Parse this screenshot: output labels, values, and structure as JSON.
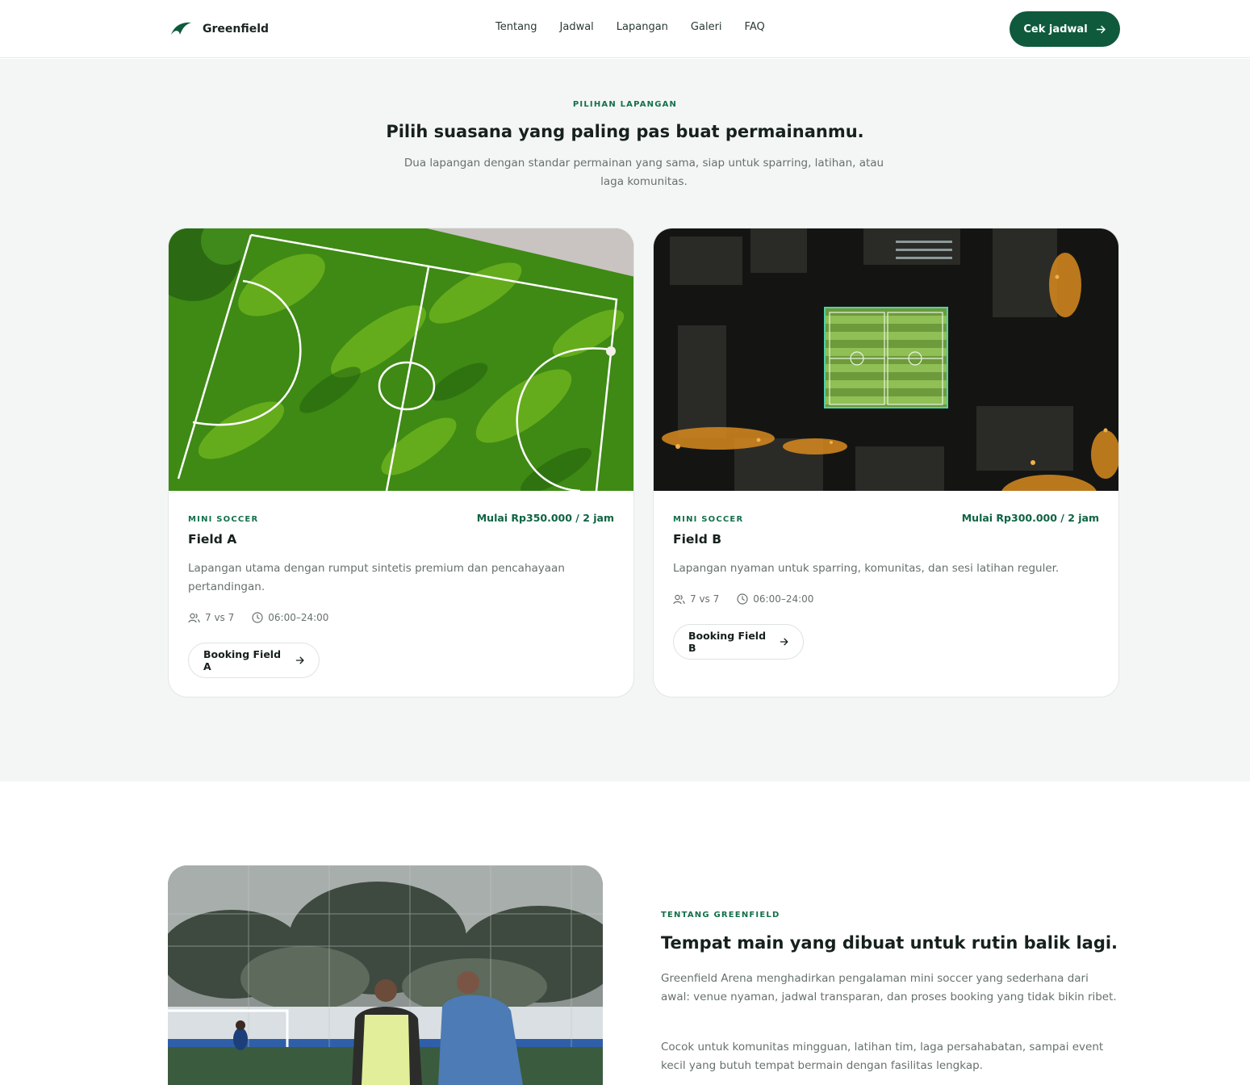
{
  "header": {
    "brand": "Greenfield",
    "nav": [
      "Tentang",
      "Jadwal",
      "Lapangan",
      "Galeri",
      "FAQ"
    ],
    "cta_label": "Cek jadwal",
    "brand_color": "#0f5a3c"
  },
  "fields": {
    "eyebrow": "PILIHAN LAPANGAN",
    "title": "Pilih suasana yang paling pas buat permainanmu.",
    "description": "Dua lapangan dengan standar permainan yang sama, siap untuk sparring, latihan, atau laga komunitas.",
    "cards": [
      {
        "tag": "MINI SOCCER",
        "price": "Mulai Rp350.000 / 2 jam",
        "name": "Field A",
        "description": "Lapangan utama dengan rumput sintetis premium dan pencahayaan pertandingan.",
        "players": "7 vs 7",
        "hours": "06:00–24:00",
        "button": "Booking Field A",
        "image": "daytime-aerial-field-photo"
      },
      {
        "tag": "MINI SOCCER",
        "price": "Mulai Rp300.000 / 2 jam",
        "name": "Field B",
        "description": "Lapangan nyaman untuk sparring, komunitas, dan sesi latihan reguler.",
        "players": "7 vs 7",
        "hours": "06:00–24:00",
        "button": "Booking Field B",
        "image": "night-aerial-field-photo"
      }
    ]
  },
  "about": {
    "eyebrow": "TENTANG GREENFIELD",
    "title": "Tempat main yang dibuat untuk rutin balik lagi.",
    "paragraph1": "Greenfield Arena menghadirkan pengalaman mini soccer yang sederhana dari awal: venue nyaman, jadwal transparan, dan proses booking yang tidak bikin ribet.",
    "paragraph2": "Cocok untuk komunitas mingguan, latihan tim, laga persahabatan, sampai event kecil yang butuh tempat bermain dengan fasilitas lengkap.",
    "image": "players-on-field-photo"
  }
}
